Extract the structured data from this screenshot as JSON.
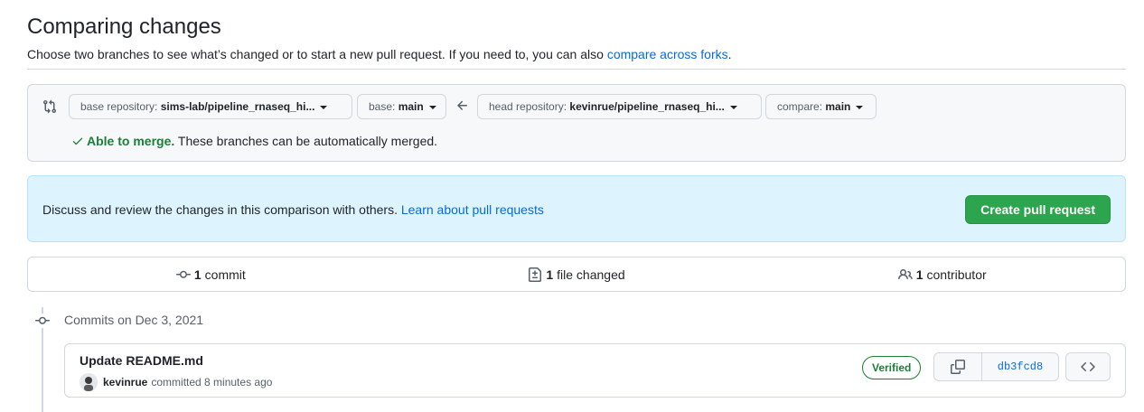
{
  "header": {
    "title": "Comparing changes",
    "subtitle_prefix": "Choose two branches to see what’s changed or to start a new pull request. If you need to, you can also ",
    "subtitle_link": "compare across forks",
    "subtitle_suffix": "."
  },
  "range": {
    "base_repo_label": "base repository: ",
    "base_repo_value": "sims-lab/pipeline_rnaseq_hi...",
    "base_label": "base: ",
    "base_value": "main",
    "head_repo_label": "head repository: ",
    "head_repo_value": "kevinrue/pipeline_rnaseq_hi...",
    "compare_label": "compare: ",
    "compare_value": "main",
    "merge_ok": "Able to merge.",
    "merge_text": " These branches can be automatically merged."
  },
  "flash": {
    "text": "Discuss and review the changes in this comparison with others. ",
    "link": "Learn about pull requests",
    "button": "Create pull request"
  },
  "stats": {
    "commits_count": "1",
    "commits_label": "commit",
    "files_count": "1",
    "files_label": "file changed",
    "contributors_count": "1",
    "contributors_label": "contributor"
  },
  "timeline": {
    "date_heading": "Commits on Dec 3, 2021"
  },
  "commit": {
    "title": "Update README.md",
    "author": "kevinrue",
    "meta": "committed 8 minutes ago",
    "verified": "Verified",
    "sha": "db3fcd8"
  },
  "colors": {
    "link": "#0969da",
    "success": "#1a7f37",
    "primary_button": "#2da44e",
    "flash_bg": "#ddf4ff"
  }
}
